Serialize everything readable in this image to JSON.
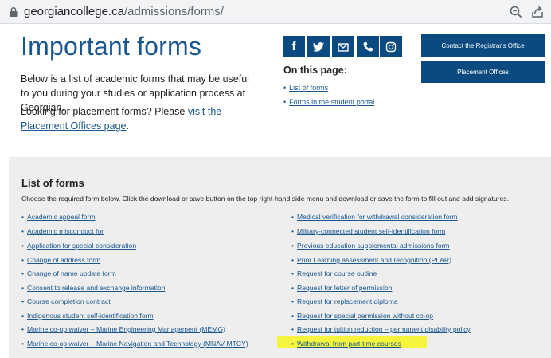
{
  "browser": {
    "url_host": "georgiancollege.ca",
    "url_path": "/admissions/forms/"
  },
  "header": {
    "title": "Important forms",
    "intro_paragraph": "Below is a list of academic forms that may be useful to you during your studies or application process at Georgian.",
    "placement_prefix": "Looking for placement forms? Please ",
    "placement_link": "visit the Placement Offices page",
    "placement_suffix": "."
  },
  "social": [
    {
      "icon": "facebook-icon",
      "glyph": "f"
    },
    {
      "icon": "twitter-icon"
    },
    {
      "icon": "email-icon"
    },
    {
      "icon": "phone-icon"
    },
    {
      "icon": "instagram-icon"
    }
  ],
  "on_this_page": {
    "title": "On this page:",
    "links": [
      "List of forms",
      "Forms in the student portal"
    ]
  },
  "buttons": {
    "contact": "Contact the Registrar's Office",
    "placement": "Placement Offices"
  },
  "forms": {
    "title": "List of forms",
    "description": "Choose the required form below. Click the download or save button on the top right-hand side menu and download or save the form to fill out and add signatures.",
    "left": [
      "Academic appeal form",
      "Academic misconduct for",
      "Application for special consideration",
      "Change of address form",
      "Change of name update form",
      "Consent to release and exchange information",
      "Course completion contract",
      "Indigenous student self-identification form",
      "Marine co-op waiver – Marine Engineering Management (MEMG)",
      "Marine co-op waiver – Marine Navigation and Technology (MNAV-MTCY)"
    ],
    "right": [
      "Medical verification for withdrawal consideration form",
      "Military-connected student self-identification form",
      "Previous education supplemental admissions form",
      "Prior Learning assessment and recognition (PLAR)",
      "Request for course outline",
      "Request for letter of permission",
      "Request for replacement diploma",
      "Request for special permission without co-op",
      "Request for tuition reduction – permanent disability policy",
      "Withdrawal from part-time courses"
    ]
  },
  "colors": {
    "brand_blue": "#0a4a80",
    "link_blue": "#1a5690",
    "highlight": "#f4f53c"
  }
}
